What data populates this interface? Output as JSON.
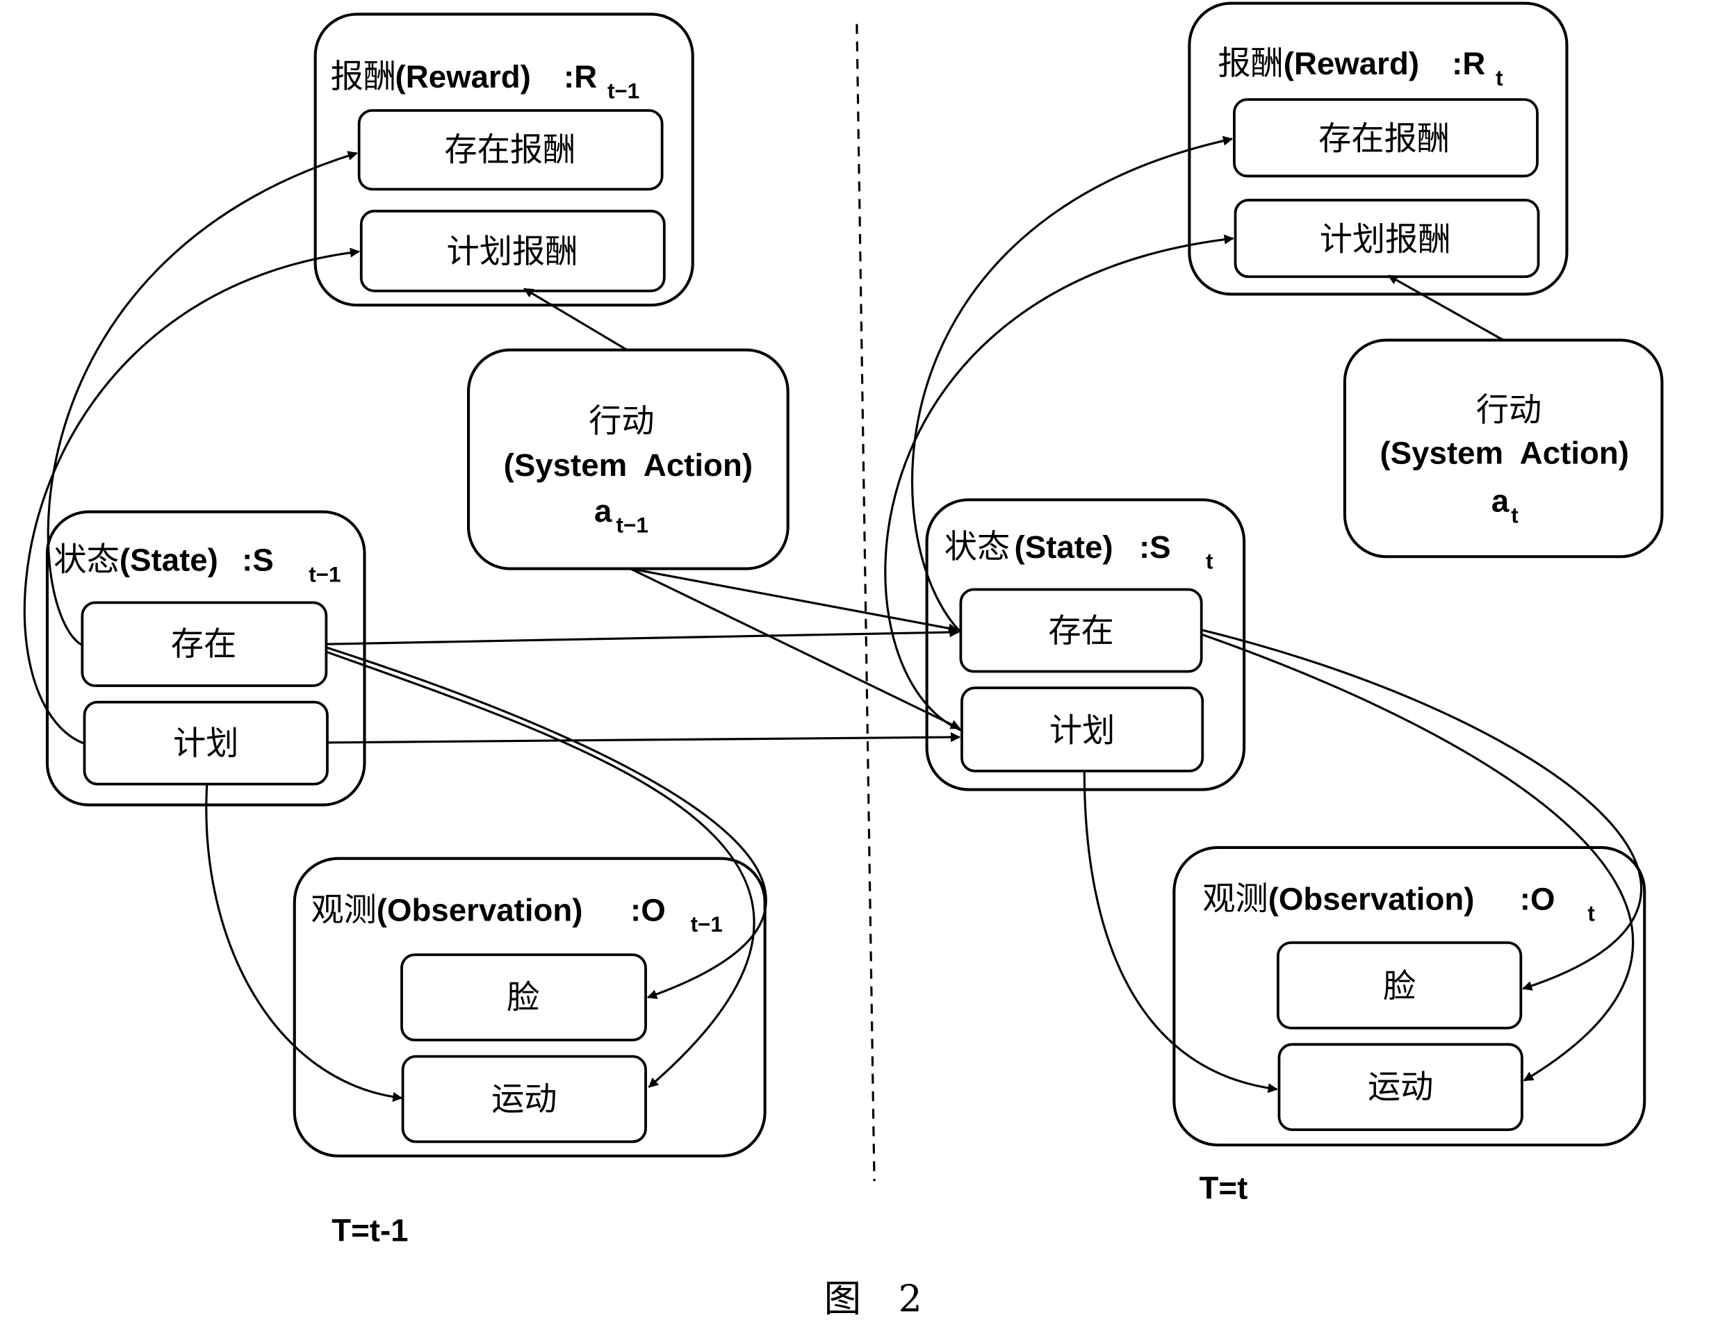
{
  "figure_caption": "图　2",
  "time_labels": {
    "prev": "T=t-1",
    "curr": "T=t"
  },
  "prev": {
    "reward": {
      "title_cn": "报酬",
      "title_en": "(Reward)",
      "sym": ":R",
      "sub": "t−1",
      "items": [
        "存在报酬",
        "计划报酬"
      ]
    },
    "action": {
      "title_cn": "行动",
      "title_en": "(System  Action)",
      "sym": "a",
      "sub": "t−1"
    },
    "state": {
      "title_cn": "状态",
      "title_en": "(State)",
      "sym": ":S",
      "sub": "t−1",
      "items": [
        "存在",
        "计划"
      ]
    },
    "observation": {
      "title_cn": "观测",
      "title_en": "(Observation)",
      "sym": ":O",
      "sub": "t−1",
      "items": [
        "脸",
        "运动"
      ]
    }
  },
  "curr": {
    "reward": {
      "title_cn": "报酬",
      "title_en": "(Reward)",
      "sym": ":R",
      "sub": "t",
      "items": [
        "存在报酬",
        "计划报酬"
      ]
    },
    "action": {
      "title_cn": "行动",
      "title_en": "(System  Action)",
      "sym": "a",
      "sub": "t"
    },
    "state": {
      "title_cn": "状态",
      "title_en": "(State)",
      "sym": ":S",
      "sub": "t",
      "items": [
        "存在",
        "计划"
      ]
    },
    "observation": {
      "title_cn": "观测",
      "title_en": "(Observation)",
      "sym": ":O",
      "sub": "t",
      "items": [
        "脸",
        "运动"
      ]
    }
  }
}
